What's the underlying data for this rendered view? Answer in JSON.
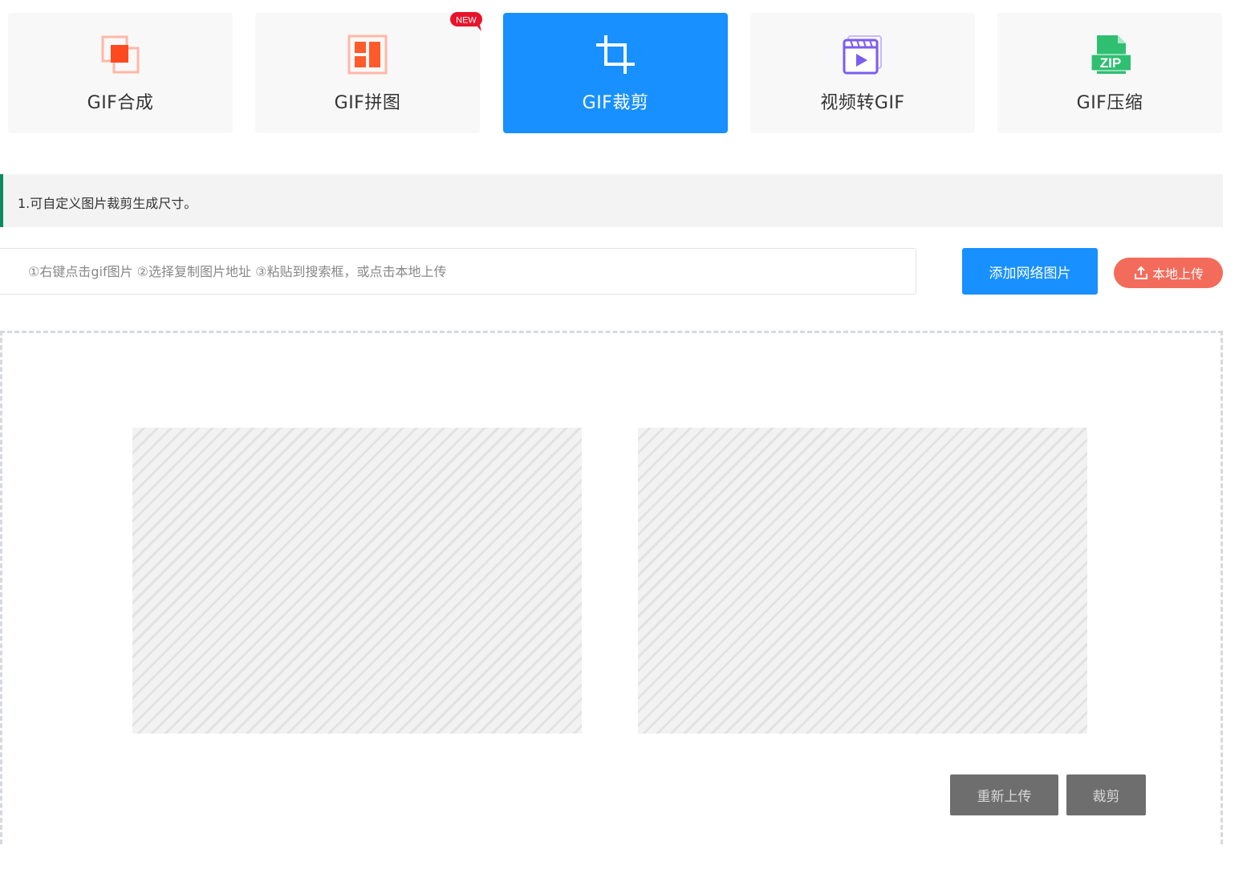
{
  "tabs": [
    {
      "label": "GIF合成",
      "icon": "gif-merge-icon",
      "active": false
    },
    {
      "label": "GIF拼图",
      "icon": "gif-collage-icon",
      "active": false,
      "badge": "NEW"
    },
    {
      "label": "GIF裁剪",
      "icon": "crop-icon",
      "active": true
    },
    {
      "label": "视频转GIF",
      "icon": "video-icon",
      "active": false
    },
    {
      "label": "GIF压缩",
      "icon": "zip-file-icon",
      "active": false,
      "icon_text": "ZIP"
    }
  ],
  "notice": {
    "text": "1.可自定义图片裁剪生成尺寸。"
  },
  "url_input": {
    "value": "",
    "placeholder": "①右键点击gif图片 ②选择复制图片地址 ③粘贴到搜索框，或点击本地上传"
  },
  "buttons": {
    "add_network_image": "添加网络图片",
    "local_upload": "本地上传",
    "reupload": "重新上传",
    "crop": "裁剪"
  },
  "colors": {
    "accent": "#1890ff",
    "upload": "#f36b5a",
    "notice_border": "#0b8a5d",
    "badge": "#e8132b",
    "merge_icon": "#ff5a36",
    "collage_icon": "#ff6a3d",
    "video_icon": "#7b5cf0",
    "zip_icon": "#2fbf71",
    "disabled_button": "#6e6e6e"
  }
}
